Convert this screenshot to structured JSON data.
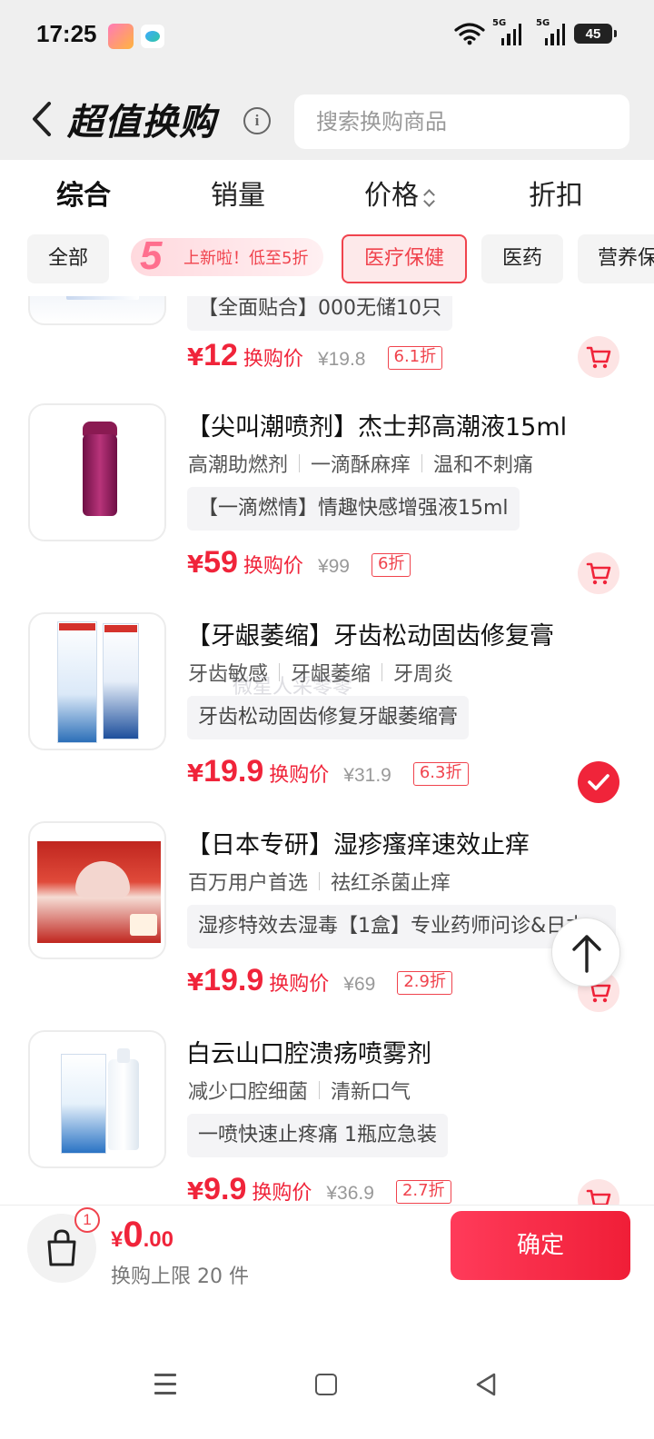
{
  "status_bar": {
    "time": "17:25",
    "network_1": "5G",
    "network_2": "5G",
    "battery": "45",
    "icons": [
      "app-notification-icon",
      "cloud-app-icon",
      "wifi-icon",
      "signal-icon",
      "battery-icon"
    ]
  },
  "header": {
    "title": "超值换购",
    "search_placeholder": "搜索换购商品"
  },
  "sort_tabs": [
    {
      "label": "综合",
      "active": true
    },
    {
      "label": "销量",
      "active": false
    },
    {
      "label": "价格",
      "active": false
    },
    {
      "label": "折扣",
      "active": false
    }
  ],
  "categories": {
    "all": "全部",
    "promo": "上新啦！低至5折",
    "promo_badge": "5",
    "items": [
      "医疗保健",
      "医药",
      "营养保"
    ],
    "selected": "医疗保健"
  },
  "products": [
    {
      "title": "",
      "sub": "【全面贴合】000无储10只",
      "price_int": "12",
      "price_label": "换购价",
      "orig": "¥19.8",
      "discount": "6.1折",
      "state": "cart"
    },
    {
      "title": "【尖叫潮喷剂】杰士邦高潮液15ml",
      "tags": [
        "高潮助燃剂",
        "一滴酥麻痒",
        "温和不刺痛"
      ],
      "sub": "【一滴燃情】情趣快感增强液15ml",
      "price_int": "59",
      "price_label": "换购价",
      "orig": "¥99",
      "discount": "6折",
      "state": "cart"
    },
    {
      "title": "【牙龈萎缩】牙齿松动固齿修复膏",
      "tags": [
        "牙齿敏感",
        "牙龈萎缩",
        "牙周炎"
      ],
      "sub": "牙齿松动固齿修复牙龈萎缩膏",
      "price_int": "19.9",
      "price_label": "换购价",
      "orig": "¥31.9",
      "discount": "6.3折",
      "state": "selected"
    },
    {
      "title": "【日本专研】湿疹瘙痒速效止痒",
      "tags": [
        "百万用户首选",
        "祛红杀菌止痒"
      ],
      "sub": "湿疹特效去湿毒【1盒】专业药师问诊&日本...",
      "price_int": "19.9",
      "price_label": "换购价",
      "orig": "¥69",
      "discount": "2.9折",
      "state": "cart"
    },
    {
      "title": "白云山口腔溃疡喷雾剂",
      "tags": [
        "减少口腔细菌",
        "清新口气"
      ],
      "sub": "一喷快速止疼痛 1瓶应急装",
      "price_int": "9.9",
      "price_label": "换购价",
      "orig": "¥36.9",
      "discount": "2.7折",
      "state": "cart"
    }
  ],
  "currency": "¥",
  "watermark": "微星人采零零",
  "bottom": {
    "badge_count": "1",
    "currency": "¥",
    "total_int": "0",
    "total_dec": ".00",
    "limit_text": "换购上限 20 件",
    "confirm_label": "确定"
  }
}
